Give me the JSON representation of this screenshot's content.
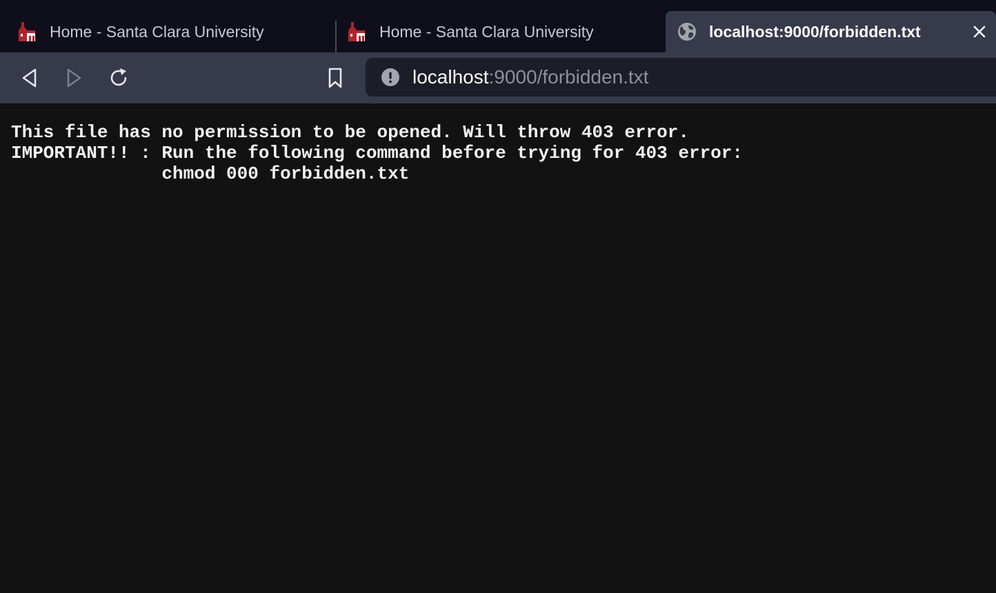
{
  "tabs": [
    {
      "title": "Home - Santa Clara University",
      "icon": "scu-mission-favicon-icon",
      "active": false
    },
    {
      "title": "Home - Santa Clara University",
      "icon": "scu-mission-favicon-icon",
      "active": false
    },
    {
      "title": "localhost:9000/forbidden.txt",
      "icon": "globe-icon",
      "active": true
    }
  ],
  "toolbar": {
    "back_icon": "back-arrow-icon",
    "forward_icon": "forward-arrow-icon",
    "reload_icon": "reload-icon",
    "bookmark_icon": "bookmark-icon"
  },
  "address_bar": {
    "host": "localhost",
    "path": ":9000/forbidden.txt",
    "security_icon": "info-icon"
  },
  "page": {
    "text": "This file has no permission to be opened. Will throw 403 error.\nIMPORTANT!! : Run the following command before trying for 403 error:\n              chmod 000 forbidden.txt"
  },
  "colors": {
    "tabstrip_bg": "#0f0f1c",
    "toolbar_bg": "#363a4a",
    "urlbar_bg": "#1b1d27",
    "page_bg": "#121212",
    "favicon_red": "#b0242c"
  }
}
